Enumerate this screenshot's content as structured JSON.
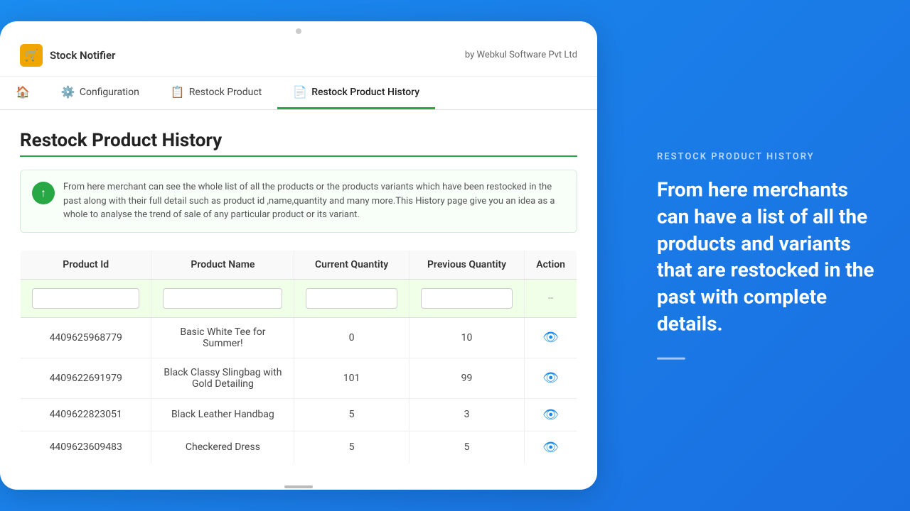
{
  "app": {
    "icon": "🛒",
    "title": "Stock Notifier",
    "by": "by Webkul Software Pvt Ltd"
  },
  "nav": {
    "tabs": [
      {
        "id": "home",
        "icon": "🏠",
        "label": "",
        "active": false
      },
      {
        "id": "configuration",
        "icon": "⚙️",
        "label": "Configuration",
        "active": false
      },
      {
        "id": "restock-product",
        "icon": "📋",
        "label": "Restock Product",
        "active": false
      },
      {
        "id": "restock-product-history",
        "icon": "📄",
        "label": "Restock Product History",
        "active": true
      }
    ]
  },
  "page": {
    "title": "Restock Product History",
    "info_text": "From here merchant can see the whole list of all the products or the products variants which have been restocked in the past along with their full detail such as product id ,name,quantity and many more.This History page give you an idea as a whole to analyse the trend of sale of any particular product or its variant."
  },
  "table": {
    "columns": [
      "Product Id",
      "Product Name",
      "Current Quantity",
      "Previous Quantity",
      "Action"
    ],
    "filter_placeholder": "--",
    "rows": [
      {
        "id": "4409625968779",
        "name": "Basic White Tee for Summer!",
        "current_qty": "0",
        "prev_qty": "10"
      },
      {
        "id": "4409622691979",
        "name": "Black Classy Slingbag with Gold Detailing",
        "current_qty": "101",
        "prev_qty": "99"
      },
      {
        "id": "4409622823051",
        "name": "Black Leather Handbag",
        "current_qty": "5",
        "prev_qty": "3"
      },
      {
        "id": "4409623609483",
        "name": "Checkered Dress",
        "current_qty": "5",
        "prev_qty": "5"
      }
    ]
  },
  "right_panel": {
    "label": "RESTOCK PRODUCT HISTORY",
    "description": "From here merchants can have a list of all the products and variants that are restocked in the past with complete details."
  }
}
